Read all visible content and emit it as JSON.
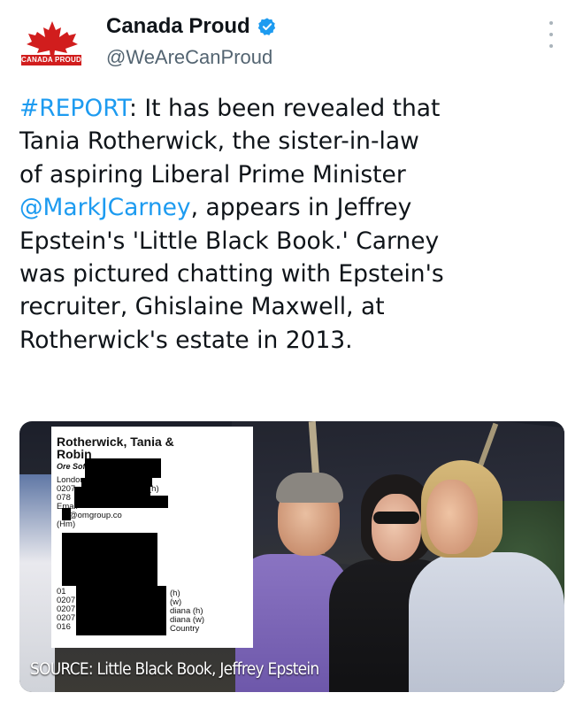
{
  "author": {
    "display_name": "Canada Proud",
    "handle": "@WeAreCanProud",
    "logo_text": "CANADA PROUD",
    "verified_icon": "verified-badge-icon",
    "avatar_icon": "maple-leaf-icon"
  },
  "tweet": {
    "lines": [
      {
        "hashtag": "#REPORT",
        "text": ": It has been revealed that"
      },
      {
        "text": "Tania Rotherwick, the sister-in-law"
      },
      {
        "text": "of aspiring Liberal Prime Minister"
      },
      {
        "mention": "@MarkJCarney",
        "text": ", appears in Jeffrey"
      },
      {
        "text": "Epstein's 'Little Black Book.' Carney"
      },
      {
        "text": "was pictured chatting with Epstein's"
      },
      {
        "text": "recruiter, Ghislaine Maxwell, at"
      },
      {
        "text": "Rotherwick's estate in 2013."
      }
    ]
  },
  "media": {
    "document": {
      "name_line1": "Rotherwick, Tania &",
      "name_line2": "Robin",
      "company": "Ore Software Ltd",
      "london": "London",
      "p1": "0207",
      "p2": "078",
      "h1": "(h)",
      "email_label": "Email",
      "email_domain": "@omgroup.co",
      "hm": "(Hm)",
      "b1": "01",
      "b2": "0207",
      "b3": "0207",
      "b4": "0207",
      "b5": "016",
      "r1": "(h)",
      "r2": "(w)",
      "r3": "diana (h)",
      "r4": "diana (w)",
      "r5": "Country"
    },
    "caption": "SOURCE: Little Black Book, Jeffrey Epstein"
  },
  "colors": {
    "link": "#1d9bf0",
    "text": "#0f1419",
    "secondary": "#536471",
    "brand_red": "#d11d1d"
  }
}
